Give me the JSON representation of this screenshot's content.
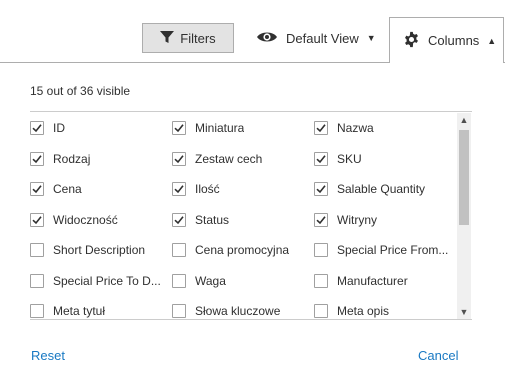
{
  "toolbar": {
    "filters_label": "Filters",
    "view_label": "Default View",
    "columns_label": "Columns"
  },
  "panel": {
    "visible_count": "15 out of 36 visible",
    "reset_label": "Reset",
    "cancel_label": "Cancel",
    "columns": [
      {
        "label": "ID",
        "checked": true
      },
      {
        "label": "Miniatura",
        "checked": true
      },
      {
        "label": "Nazwa",
        "checked": true
      },
      {
        "label": "Rodzaj",
        "checked": true
      },
      {
        "label": "Zestaw cech",
        "checked": true
      },
      {
        "label": "SKU",
        "checked": true
      },
      {
        "label": "Cena",
        "checked": true
      },
      {
        "label": "Ilość",
        "checked": true
      },
      {
        "label": "Salable Quantity",
        "checked": true
      },
      {
        "label": "Widoczność",
        "checked": true
      },
      {
        "label": "Status",
        "checked": true
      },
      {
        "label": "Witryny",
        "checked": true
      },
      {
        "label": "Short Description",
        "checked": false
      },
      {
        "label": "Cena promocyjna",
        "checked": false
      },
      {
        "label": "Special Price From...",
        "checked": false
      },
      {
        "label": "Special Price To D...",
        "checked": false
      },
      {
        "label": "Waga",
        "checked": false
      },
      {
        "label": "Manufacturer",
        "checked": false
      },
      {
        "label": "Meta tytuł",
        "checked": false
      },
      {
        "label": "Słowa kluczowe",
        "checked": false
      },
      {
        "label": "Meta opis",
        "checked": false
      }
    ]
  },
  "icons": {
    "filter": "funnel-icon",
    "view": "eye-icon",
    "columns": "gear-icon",
    "check": "checkmark-icon"
  },
  "colors": {
    "link": "#1979c3",
    "text": "#303030",
    "border": "#adadad",
    "button_bg": "#e3e3e3"
  }
}
